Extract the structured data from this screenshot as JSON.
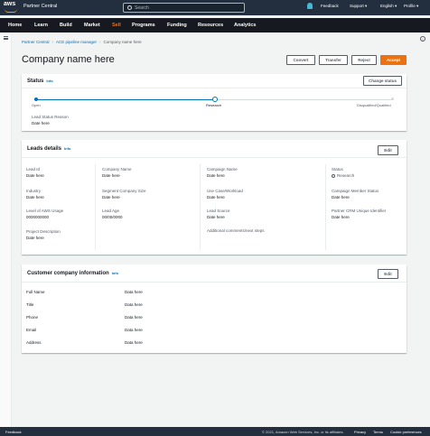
{
  "top": {
    "logo": "aws",
    "brand": "Partner Central",
    "search_placeholder": "Search",
    "feedback": "Feedback",
    "support": "Support ▾",
    "language": "English ▾",
    "profile": "Profile ▾"
  },
  "nav": [
    "Home",
    "Learn",
    "Build",
    "Market",
    "Sell",
    "Programs",
    "Funding",
    "Resources",
    "Analytics"
  ],
  "nav_active": "Sell",
  "breadcrumbs": [
    "Partner Central",
    "ACE pipeline manager",
    "Company name here"
  ],
  "page_title": "Company name here",
  "actions": {
    "convert": "Convert",
    "transfer": "Transfer",
    "reject": "Reject",
    "accept": "Accept"
  },
  "status": {
    "title": "Status",
    "info": "Info",
    "change_btn": "Change status",
    "steps": [
      "Open",
      "Research",
      "Disqualified/Qualified"
    ],
    "current_step": 2,
    "reason_label": "Lead Status Reason",
    "reason_value": "Date here"
  },
  "leads": {
    "title": "Leads details",
    "info": "Info",
    "edit": "Edit",
    "fields": {
      "lead_id": {
        "label": "Lead Id",
        "value": "Date here"
      },
      "industry": {
        "label": "Industry",
        "value": "Date here"
      },
      "aws_usage": {
        "label": "Level of AWS Usage",
        "value": "0000000000"
      },
      "project_desc": {
        "label": "Project Description",
        "value": "Date here"
      },
      "company_name": {
        "label": "Company Name",
        "value": "Date here"
      },
      "segment_size": {
        "label": "Segment Company Size",
        "value": "Date here"
      },
      "lead_age": {
        "label": "Lead Age",
        "value": "00/00/0000"
      },
      "campaign_name": {
        "label": "Campaign Name",
        "value": "Date here"
      },
      "use_case": {
        "label": "Use Case/Workload",
        "value": "Date here"
      },
      "lead_source": {
        "label": "Lead Source",
        "value": "Date here"
      },
      "additional": {
        "label": "Additional comments/next steps"
      },
      "status": {
        "label": "Status",
        "value": "Research"
      },
      "member_status": {
        "label": "Campaign Member Status",
        "value": "Date here"
      },
      "crm_id": {
        "label": "Partner CRM Unique Identifier",
        "value": "Date here"
      }
    }
  },
  "customer": {
    "title": "Customer company information",
    "info": "Info",
    "edit": "Edit",
    "rows": [
      {
        "label": "Full Name",
        "value": "Data here"
      },
      {
        "label": "Title",
        "value": "Data here"
      },
      {
        "label": "Phone",
        "value": "Data here"
      },
      {
        "label": "Email",
        "value": "Data here"
      },
      {
        "label": "Address",
        "value": "Data here"
      }
    ]
  },
  "footer": {
    "feedback": "Feedback",
    "copyright": "© 2021, Amazon Web Services, Inc. or its affiliates.",
    "privacy": "Privacy",
    "terms": "Terms",
    "cookies": "Cookie preferences"
  },
  "colors": {
    "accent": "#ec7211",
    "link": "#0073bb",
    "header_bg": "#232f3e",
    "nav_bg": "#16191f"
  }
}
